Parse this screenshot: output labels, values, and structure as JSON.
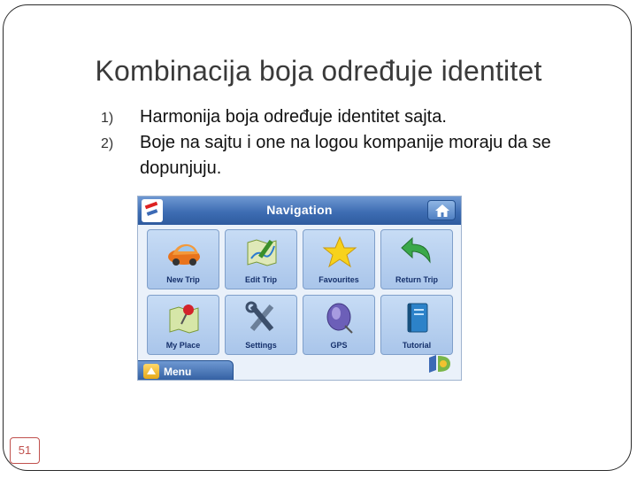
{
  "slide": {
    "title": "Kombinacija boja određuje identitet",
    "page_number": "51"
  },
  "bullets": [
    {
      "num": "1)",
      "text": "Harmonija boja određuje identitet sajta."
    },
    {
      "num": "2)",
      "text": "Boje na sajtu i one na logou kompanije moraju da se dopunjuju."
    }
  ],
  "navigation_screenshot": {
    "title": "Navigation",
    "tiles": [
      {
        "label": "New Trip",
        "icon": "car-icon"
      },
      {
        "label": "Edit Trip",
        "icon": "map-pen-icon"
      },
      {
        "label": "Favourites",
        "icon": "star-icon"
      },
      {
        "label": "Return Trip",
        "icon": "return-arrow-icon"
      },
      {
        "label": "My Place",
        "icon": "map-pin-icon"
      },
      {
        "label": "Settings",
        "icon": "tools-icon"
      },
      {
        "label": "GPS",
        "icon": "satellite-icon"
      },
      {
        "label": "Tutorial",
        "icon": "book-icon"
      }
    ],
    "menu_label": "Menu",
    "colors": {
      "bar": "#3e6db3",
      "tile": "#b7d0ef",
      "accent_orange": "#e8731c"
    }
  }
}
